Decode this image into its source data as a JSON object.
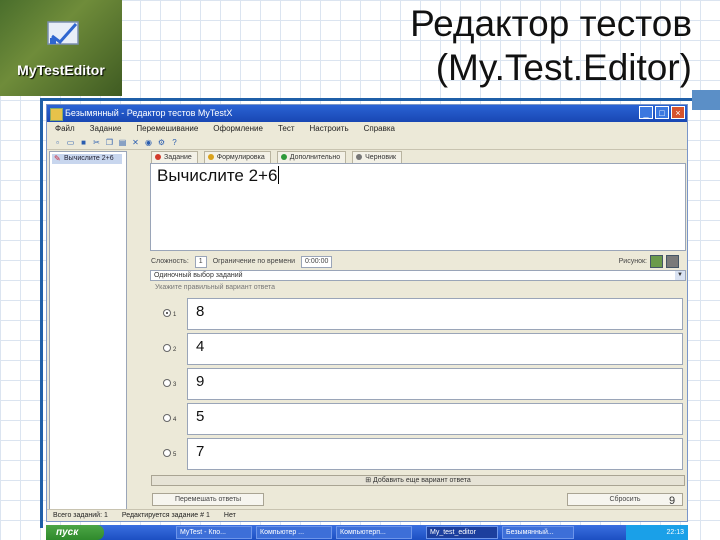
{
  "slide": {
    "title_line1": "Редактор тестов",
    "title_line2": "(My.Test.Editor)",
    "page_number": "9"
  },
  "logo": {
    "label": "MyTestEditor",
    "icon": "chart-check-icon"
  },
  "window": {
    "title": "Безымянный - Редактор тестов MyTestX",
    "menu": [
      "Файл",
      "Задание",
      "Перемешивание",
      "Оформление",
      "Тест",
      "Настроить",
      "Справка"
    ],
    "toolbar_icons": [
      "new-icon",
      "open-icon",
      "save-icon",
      "cut-icon",
      "copy-icon",
      "paste-icon",
      "delete-icon",
      "preview-icon",
      "settings-icon",
      "help-icon"
    ]
  },
  "sidebar": {
    "item_label": "Вычислите 2+6"
  },
  "tabs": [
    {
      "label": "Задание",
      "color": "#d23b2b"
    },
    {
      "label": "Формулировка",
      "color": "#d9a21c"
    },
    {
      "label": "Дополнительно",
      "color": "#2e9a3a"
    },
    {
      "label": "Черновик",
      "color": "#777777"
    }
  ],
  "question": {
    "text": "Вычислите 2+6"
  },
  "properties": {
    "difficulty_label": "Сложность:",
    "difficulty_value": "1",
    "time_limit_label": "Ограничение по времени",
    "time_value": "0:00:00",
    "picture_label": "Рисунок:"
  },
  "answer_type": {
    "value": "Одиночный выбор заданий"
  },
  "answers_hint": "Укажите правильный вариант ответа",
  "answers": [
    {
      "num": "1",
      "text": "8",
      "selected": true
    },
    {
      "num": "2",
      "text": "4",
      "selected": false
    },
    {
      "num": "3",
      "text": "9",
      "selected": false
    },
    {
      "num": "4",
      "text": "5",
      "selected": false
    },
    {
      "num": "5",
      "text": "7",
      "selected": false
    }
  ],
  "add_answer_label": "Добавить еще вариант ответа",
  "bottom_left_button": "Перемешать ответы",
  "bottom_right_button": "Сбросить",
  "status": {
    "total": "Всего заданий: 1",
    "editing": "Редактируется задание # 1",
    "mode": "Нет"
  },
  "taskbar": {
    "start": "пуск",
    "tasks": [
      "MyTest - Кпо...",
      "Компьютер ...",
      "Компьютерп...",
      "My_test_editor",
      "Безымянный..."
    ],
    "clock": "22:13"
  }
}
